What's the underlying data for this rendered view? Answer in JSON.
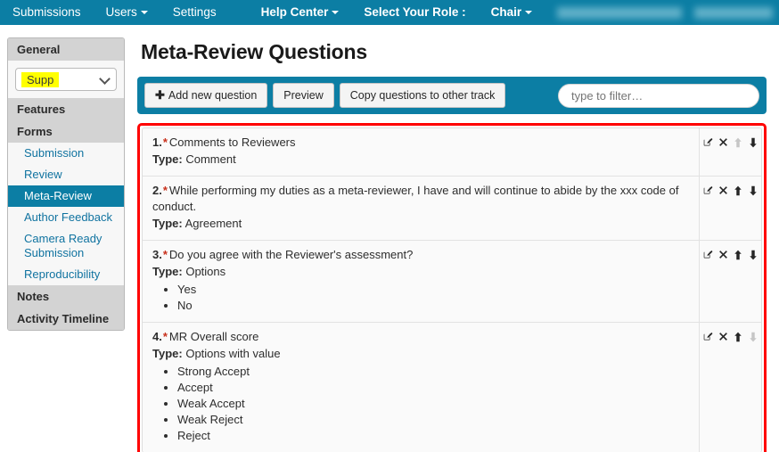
{
  "navbar": {
    "items": [
      {
        "label": "Submissions",
        "caret": false,
        "bold": false
      },
      {
        "label": "Users",
        "caret": true,
        "bold": false
      },
      {
        "label": "Settings",
        "caret": false,
        "bold": false
      }
    ],
    "right_items": [
      {
        "label": "Help Center",
        "caret": true,
        "bold": true
      },
      {
        "label": "Select Your Role :",
        "caret": false,
        "bold": true
      },
      {
        "label": "Chair",
        "caret": true,
        "bold": true
      }
    ],
    "background_color": "#0c7ea4"
  },
  "sidebar": {
    "general_header": "General",
    "track_select": {
      "value": "Supp",
      "highlight_color": "#ffff00",
      "chevron_icon": "chevron-down-icon"
    },
    "sections": [
      {
        "type": "header",
        "label": "Features"
      },
      {
        "type": "header",
        "label": "Forms"
      },
      {
        "type": "link",
        "label": "Submission",
        "active": false
      },
      {
        "type": "link",
        "label": "Review",
        "active": false
      },
      {
        "type": "link",
        "label": "Meta-Review",
        "active": true
      },
      {
        "type": "link",
        "label": "Author Feedback",
        "active": false
      },
      {
        "type": "link",
        "label": "Camera Ready Submission",
        "active": false
      },
      {
        "type": "link",
        "label": "Reproducibility",
        "active": false
      },
      {
        "type": "header",
        "label": "Notes"
      },
      {
        "type": "header",
        "label": "Activity Timeline"
      }
    ],
    "link_color": "#1073a0",
    "active_color": "#0c7ea4"
  },
  "main": {
    "title": "Meta-Review Questions",
    "toolbar": {
      "add_label": "Add new question",
      "add_icon": "plus-icon",
      "preview_label": "Preview",
      "copy_label": "Copy questions to other track",
      "filter_placeholder": "type to filter…",
      "filter_value": "",
      "background_color": "#0c7ea4"
    },
    "annotation": {
      "color": "#ff0000"
    },
    "action_icons": {
      "edit": "edit-square-icon",
      "delete": "delete-x-icon",
      "move_up": "arrow-up-icon",
      "move_down": "arrow-down-icon"
    },
    "type_label": "Type:",
    "questions": [
      {
        "number": "1.",
        "required": "*",
        "text": "Comments to Reviewers",
        "type": "Comment",
        "options": [],
        "up_enabled": false,
        "down_enabled": true
      },
      {
        "number": "2.",
        "required": "*",
        "text": "While performing my duties as a meta-reviewer, I have and will continue to abide by the xxx code of conduct.",
        "type": "Agreement",
        "options": [],
        "up_enabled": true,
        "down_enabled": true
      },
      {
        "number": "3.",
        "required": "*",
        "text": "Do you agree with the Reviewer's assessment?",
        "type": "Options",
        "options": [
          "Yes",
          "No"
        ],
        "up_enabled": true,
        "down_enabled": true
      },
      {
        "number": "4.",
        "required": "*",
        "text": "MR Overall score",
        "type": "Options with value",
        "options": [
          "Strong Accept",
          "Accept",
          "Weak Accept",
          "Weak Reject",
          "Reject"
        ],
        "up_enabled": true,
        "down_enabled": false
      }
    ]
  }
}
